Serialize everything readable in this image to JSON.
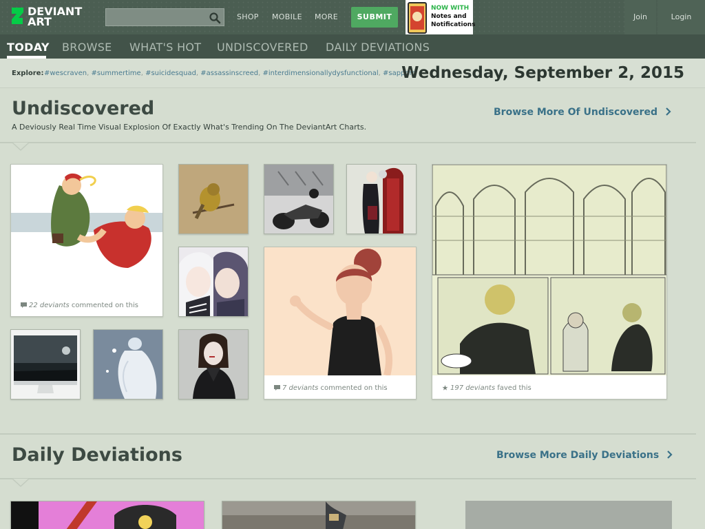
{
  "header": {
    "logo_line1": "DEVIANT",
    "logo_line2": "ART",
    "search_placeholder": "",
    "nav": [
      "SHOP",
      "MOBILE",
      "MORE"
    ],
    "submit_label": "SUBMIT",
    "promo": {
      "line1": "NOW WITH",
      "line2": "Notes and",
      "line3": "Notifications"
    },
    "join_label": "Join",
    "login_label": "Login"
  },
  "tabs": [
    {
      "label": "TODAY",
      "active": true
    },
    {
      "label": "BROWSE"
    },
    {
      "label": "WHAT'S HOT"
    },
    {
      "label": "UNDISCOVERED"
    },
    {
      "label": "DAILY DEVIATIONS"
    }
  ],
  "explore": {
    "label": "Explore:",
    "tags": [
      "#wescraven",
      "#summertime",
      "#suicidesquad",
      "#assassinscreed",
      "#interdimensionallydysfunctional",
      "#sapporo"
    ]
  },
  "date": "Wednesday, September 2, 2015",
  "undiscovered": {
    "title": "Undiscovered",
    "description": "A Deviously Real Time Visual Explosion Of Exactly What's Trending On The DeviantArt Charts.",
    "browse_more": "Browse More Of Undiscovered",
    "cards": [
      {
        "count": "22 deviants",
        "suffix": " commented on this"
      },
      {
        "count": "7 deviants",
        "suffix": " commented on this"
      },
      {
        "count": "197 deviants",
        "suffix": " faved this"
      }
    ]
  },
  "daily": {
    "title": "Daily Deviations",
    "browse_more": "Browse More Daily Deviations"
  },
  "colors": {
    "topbar": "#4b5e52",
    "tabbar": "#425349",
    "page_bg": "#d5ddd0",
    "submit_green": "#4fa961",
    "link_blue": "#3a7188"
  }
}
